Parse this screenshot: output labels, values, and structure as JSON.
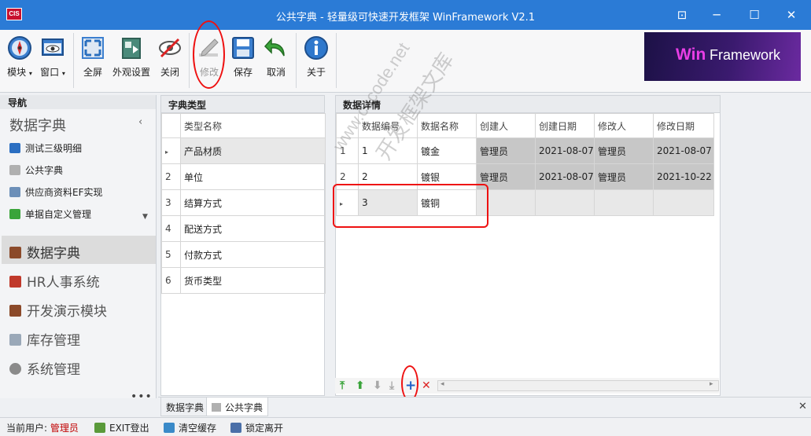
{
  "window": {
    "app_icon_text": "CIS",
    "title": "公共字典 - 轻量级可快速开发框架 WinFramework V2.1"
  },
  "toolbar": {
    "module": "模块",
    "window": "窗口",
    "fullscreen": "全屏",
    "appearance": "外观设置",
    "close": "关闭",
    "edit": "修改",
    "save": "保存",
    "cancel": "取消",
    "about": "关于"
  },
  "logo": {
    "win": "Win",
    "framework": "Framework"
  },
  "nav": {
    "header": "导航",
    "group_title": "数据字典",
    "sub_items": [
      "测试三级明细",
      "公共字典",
      "供应商资料EF实现",
      "单据自定义管理"
    ],
    "modules": [
      "数据字典",
      "HR人事系统",
      "开发演示模块",
      "库存管理",
      "系统管理"
    ],
    "more": "•••"
  },
  "dict_types": {
    "header": "字典类型",
    "column": "类型名称",
    "rows": [
      {
        "num": "",
        "name": "产品材质"
      },
      {
        "num": "2",
        "name": "单位"
      },
      {
        "num": "3",
        "name": "结算方式"
      },
      {
        "num": "4",
        "name": "配送方式"
      },
      {
        "num": "5",
        "name": "付款方式"
      },
      {
        "num": "6",
        "name": "货币类型"
      }
    ]
  },
  "data_details": {
    "header": "数据详情",
    "columns": [
      "数据编号",
      "数据名称",
      "创建人",
      "创建日期",
      "修改人",
      "修改日期"
    ],
    "rows": [
      {
        "num": "1",
        "code": "1",
        "name": "镀金",
        "creator": "管理员",
        "created": "2021-08-07",
        "editor": "管理员",
        "edited": "2021-08-07"
      },
      {
        "num": "2",
        "code": "2",
        "name": "镀银",
        "creator": "管理员",
        "created": "2021-08-07",
        "editor": "管理员",
        "edited": "2021-10-22"
      },
      {
        "num": "",
        "code": "3",
        "name": "镀铜",
        "creator": "",
        "created": "",
        "editor": "",
        "edited": ""
      }
    ]
  },
  "watermark": {
    "line1": "www.cscode.net",
    "line2": "开发框架文库"
  },
  "tabs": [
    "数据字典",
    "公共字典"
  ],
  "status": {
    "user_label": "当前用户:",
    "user_name": "管理员",
    "exit": "EXIT登出",
    "clear_cache": "清空缓存",
    "lock": "锁定离开"
  },
  "colors": {
    "accent": "#2b7bd6",
    "user_name": "#c00000",
    "annotation": "#e11111"
  }
}
